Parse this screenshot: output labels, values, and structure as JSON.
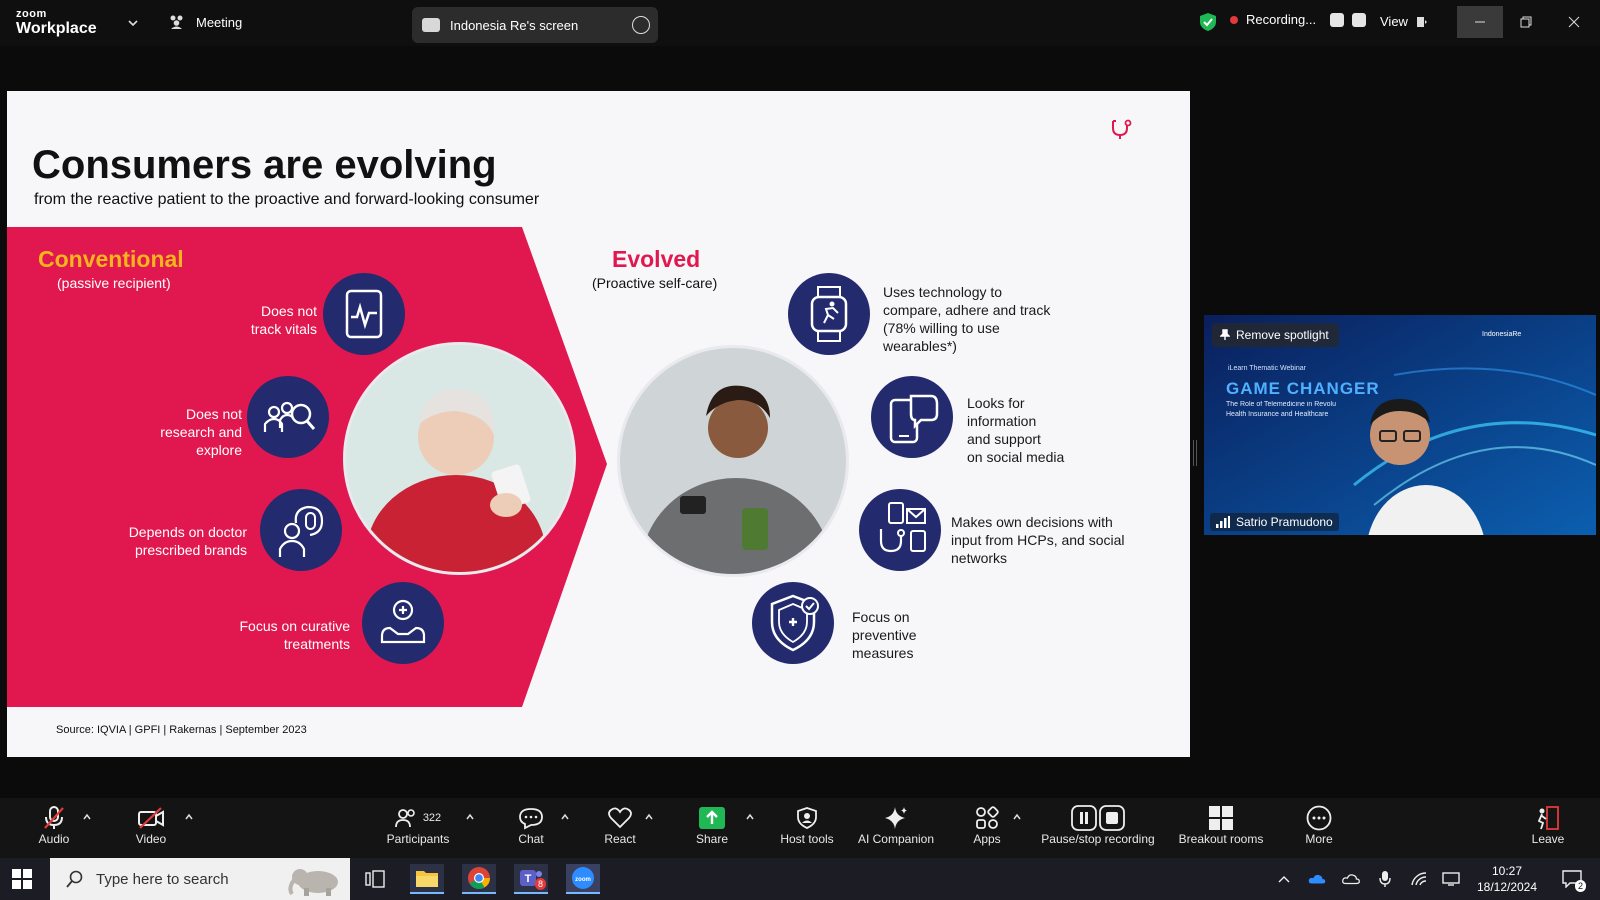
{
  "app": {
    "brand_top": "zoom",
    "brand_bottom": "Workplace",
    "meeting_label": "Meeting"
  },
  "share": {
    "label": "Indonesia Re's screen"
  },
  "recording": {
    "label": "Recording..."
  },
  "view": {
    "label": "View"
  },
  "slide": {
    "title": "Consumers are evolving",
    "subtitle": "from the reactive patient to the proactive and forward-looking consumer",
    "conventional": {
      "title": "Conventional",
      "subtitle": "(passive recipient)",
      "items": [
        "Does not\ntrack vitals",
        "Does not\nresearch and\nexplore",
        "Depends on doctor\nprescribed brands",
        "Focus on curative\ntreatments"
      ]
    },
    "evolved": {
      "title": "Evolved",
      "subtitle": "(Proactive self-care)",
      "items": [
        "Uses technology to\ncompare, adhere and track\n(78% willing to use\nwearables*)",
        "Looks for\ninformation\nand support\non social media",
        "Makes own decisions with\ninput from HCPs, and social\nnetworks",
        "Focus on\npreventive\nmeasures"
      ]
    },
    "source": "Source: IQVIA | GPFI |  Rakernas | September 2023"
  },
  "video": {
    "spotlight_label": "Remove spotlight",
    "participant_name": "Satrio Pramudono",
    "bg_small_top": "iLearn Thematic Webinar",
    "bg_headline": "GAME CHANGER",
    "bg_line1": "The Role of Telemedicine in Revolu",
    "bg_line2": "Health Insurance and Healthcare",
    "bg_logo": "IndonesiaRe"
  },
  "toolbar": {
    "audio": "Audio",
    "video": "Video",
    "participants": "Participants",
    "participants_count": "322",
    "chat": "Chat",
    "react": "React",
    "share": "Share",
    "host_tools": "Host tools",
    "ai_companion": "AI Companion",
    "apps": "Apps",
    "pause_stop": "Pause/stop recording",
    "breakout": "Breakout rooms",
    "more": "More",
    "leave": "Leave"
  },
  "taskbar": {
    "search_placeholder": "Type here to search",
    "time": "10:27",
    "date": "18/12/2024",
    "teams_badge": "8",
    "notif_count": "2"
  },
  "colors": {
    "pink": "#e0184f",
    "navy": "#232a6e",
    "gold": "#f7b51c",
    "share_green": "#1fb854"
  }
}
